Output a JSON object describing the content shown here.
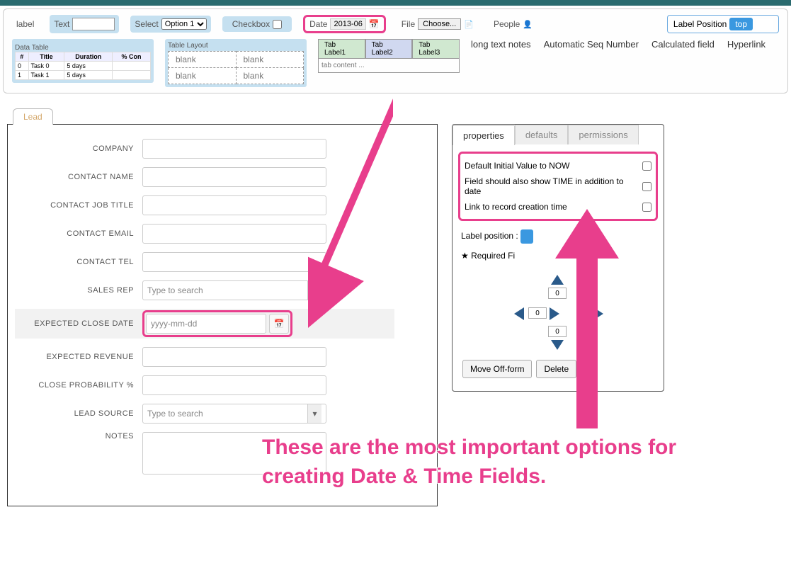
{
  "toolbox": {
    "label": "label",
    "text": "Text",
    "select_label": "Select",
    "select_option": "Option 1",
    "checkbox": "Checkbox",
    "date_label": "Date",
    "date_value": "2013-06",
    "file_label": "File",
    "file_btn": "Choose...",
    "people": "People",
    "label_position": "Label Position",
    "label_position_val": "top",
    "data_table": "Data Table",
    "table_cols": [
      "#",
      "Title",
      "Duration",
      "% Con"
    ],
    "table_rows": [
      [
        "0",
        "Task 0",
        "5 days",
        ""
      ],
      [
        "1",
        "Task 1",
        "5 days",
        ""
      ]
    ],
    "table_layout": "Table Layout",
    "blank": "blank",
    "tabs": [
      "Tab Label1",
      "Tab Label2",
      "Tab Label3"
    ],
    "tab_content": "tab content ...",
    "more": {
      "long_text": "long text notes",
      "seq": "Automatic Seq Number",
      "calc": "Calculated field",
      "hyperlink": "Hyperlink"
    }
  },
  "form": {
    "tab": "Lead",
    "fields": {
      "company": "COMPANY",
      "contact_name": "CONTACT NAME",
      "contact_job": "CONTACT JOB TITLE",
      "contact_email": "CONTACT EMAIL",
      "contact_tel": "CONTACT TEL",
      "sales_rep": "SALES REP",
      "expected_close": "EXPECTED CLOSE DATE",
      "expected_rev": "EXPECTED REVENUE",
      "close_prob": "CLOSE PROBABILITY %",
      "lead_source": "LEAD SOURCE",
      "notes": "NOTES"
    },
    "search_placeholder": "Type to search",
    "date_placeholder": "yyyy-mm-dd"
  },
  "props": {
    "tabs": {
      "properties": "properties",
      "defaults": "defaults",
      "permissions": "permissions"
    },
    "opts": {
      "now": "Default Initial Value to NOW",
      "time": "Field should also show TIME in addition to date",
      "link": "Link to record creation time"
    },
    "label_position": "Label position :",
    "required": "Required Fi",
    "pad": "0",
    "move_off": "Move Off-form",
    "delete": "Delete"
  },
  "annotation": "These are the most important options for creating Date & Time Fields."
}
